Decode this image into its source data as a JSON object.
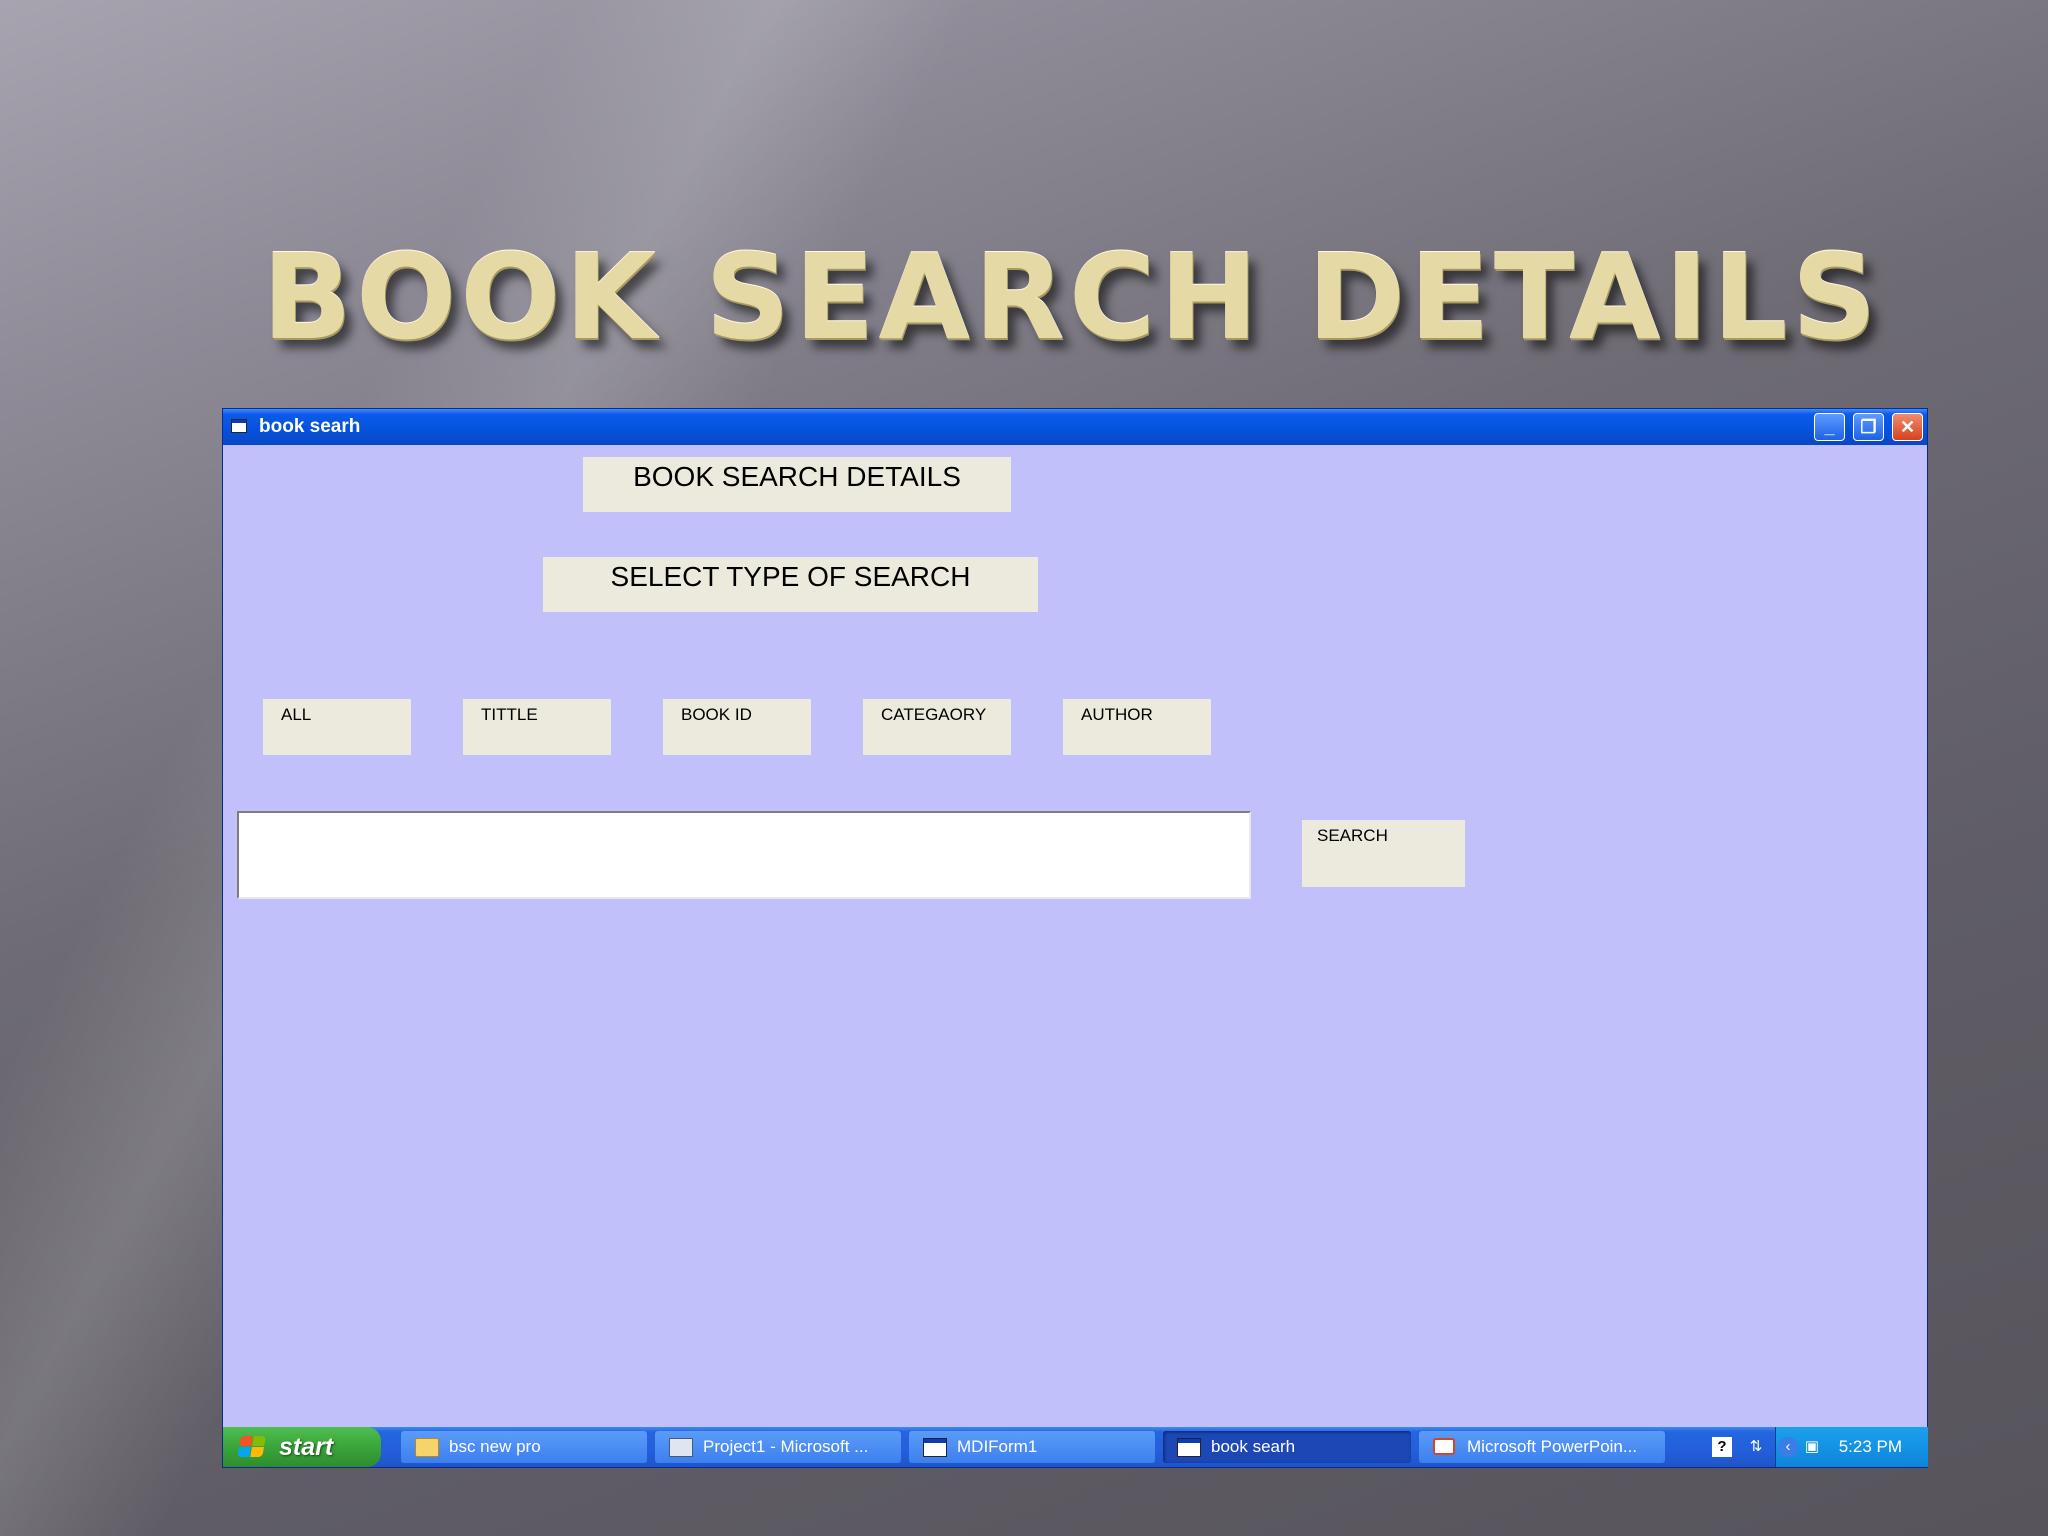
{
  "slide": {
    "title": "BOOK SEARCH DETAILS"
  },
  "window": {
    "title": "book searh",
    "controls": {
      "minimize": "_",
      "restore": "❐",
      "close": "✕"
    }
  },
  "form": {
    "heading": "BOOK SEARCH DETAILS",
    "subheading": "SELECT TYPE OF SEARCH",
    "options": [
      "ALL",
      "TITTLE",
      "BOOK ID",
      "CATEGAORY",
      "AUTHOR"
    ],
    "search_input_value": "",
    "search_button": "SEARCH"
  },
  "taskbar": {
    "start_label": "start",
    "tasks": [
      {
        "label": "bsc new pro",
        "icon": "folder-icon"
      },
      {
        "label": "Project1 - Microsoft ...",
        "icon": "vb-project-icon"
      },
      {
        "label": "MDIForm1",
        "icon": "form-window-icon"
      },
      {
        "label": "book searh",
        "icon": "form-window-icon",
        "active": true
      },
      {
        "label": "Microsoft PowerPoin...",
        "icon": "powerpoint-icon"
      }
    ],
    "clock": "5:23 PM",
    "tray_icons": [
      "help-icon",
      "network-icon",
      "arrow-left-icon",
      "monitor-icon"
    ]
  },
  "colors": {
    "form_background": "#c2c0fb",
    "control_face": "#ece9dd",
    "titlebar_blue": "#0452dc",
    "title_gold": "#e5d9a6"
  }
}
